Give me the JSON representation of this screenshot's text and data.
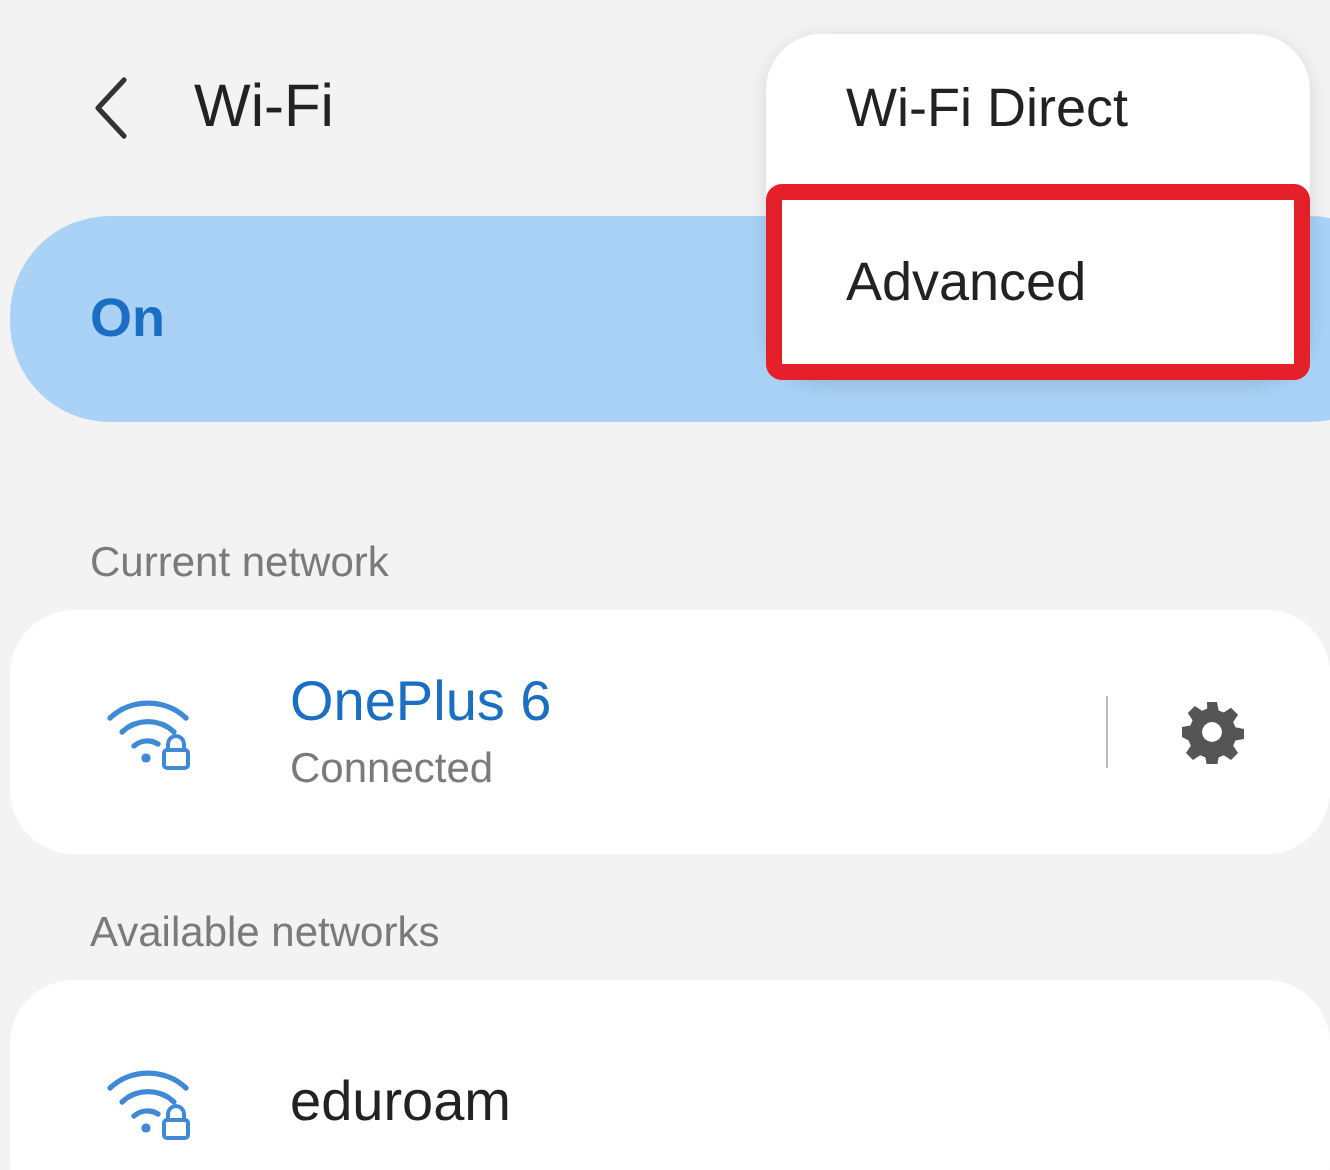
{
  "header": {
    "title": "Wi-Fi"
  },
  "master_switch": {
    "label": "On",
    "on": true
  },
  "menu": {
    "items": [
      {
        "label": "Wi-Fi Direct",
        "highlighted": false
      },
      {
        "label": "Advanced",
        "highlighted": true
      }
    ]
  },
  "sections": [
    {
      "title": "Current network",
      "networks": [
        {
          "name": "OnePlus 6",
          "status": "Connected",
          "connected": true,
          "secured": true
        }
      ]
    },
    {
      "title": "Available networks",
      "networks": [
        {
          "name": "eduroam",
          "connected": false,
          "secured": true
        }
      ]
    }
  ]
}
